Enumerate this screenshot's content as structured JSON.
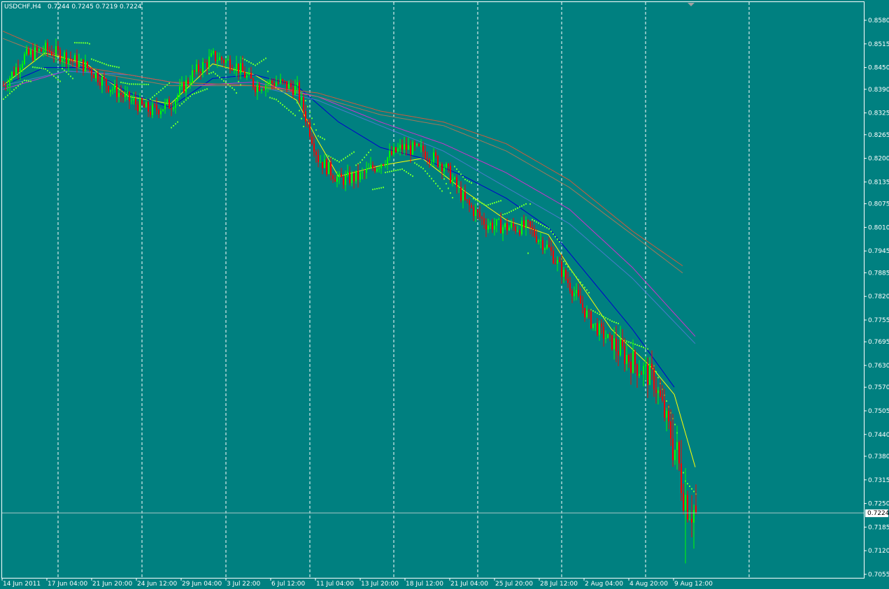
{
  "header": {
    "symbol": "USDCHF,H4",
    "ohlc": "0.7244 0.7245 0.7219 0.7224"
  },
  "current_price_label": "0.7224",
  "chart_data": {
    "type": "candlestick",
    "symbol": "USDCHF",
    "timeframe": "H4",
    "ylim": [
      0.7055,
      0.8605
    ],
    "y_ticks": [
      "0.8580",
      "0.8515",
      "0.8450",
      "0.8390",
      "0.8325",
      "0.8265",
      "0.8200",
      "0.8135",
      "0.8075",
      "0.8010",
      "0.7945",
      "0.7885",
      "0.7820",
      "0.7755",
      "0.7695",
      "0.7630",
      "0.7570",
      "0.7505",
      "0.7440",
      "0.7380",
      "0.7315",
      "0.7250",
      "0.7185",
      "0.7120",
      "0.7055"
    ],
    "x_ticks": [
      "14 Jun 2011",
      "17 Jun 04:00",
      "21 Jun 20:00",
      "24 Jun 12:00",
      "29 Jun 04:00",
      "3 Jul 22:00",
      "6 Jul 12:00",
      "11 Jul 04:00",
      "13 Jul 20:00",
      "18 Jul 12:00",
      "21 Jul 04:00",
      "25 Jul 20:00",
      "28 Jul 12:00",
      "2 Aug 04:00",
      "4 Aug 20:00",
      "9 Aug 12:00"
    ],
    "grid": "vertical dashed separators",
    "current_price": 0.7224,
    "close_path": [
      [
        0,
        0.84
      ],
      [
        10,
        0.848
      ],
      [
        20,
        0.85
      ],
      [
        30,
        0.848
      ],
      [
        40,
        0.845
      ],
      [
        50,
        0.84
      ],
      [
        60,
        0.836
      ],
      [
        70,
        0.833
      ],
      [
        80,
        0.835
      ],
      [
        90,
        0.843
      ],
      [
        100,
        0.848
      ],
      [
        110,
        0.846
      ],
      [
        120,
        0.84
      ],
      [
        130,
        0.841
      ],
      [
        140,
        0.839
      ],
      [
        150,
        0.82
      ],
      [
        160,
        0.814
      ],
      [
        170,
        0.815
      ],
      [
        180,
        0.819
      ],
      [
        190,
        0.823
      ],
      [
        200,
        0.822
      ],
      [
        210,
        0.818
      ],
      [
        220,
        0.808
      ],
      [
        230,
        0.802
      ],
      [
        240,
        0.801
      ],
      [
        250,
        0.801
      ],
      [
        260,
        0.795
      ],
      [
        270,
        0.785
      ],
      [
        280,
        0.775
      ],
      [
        290,
        0.769
      ],
      [
        300,
        0.764
      ],
      [
        310,
        0.759
      ],
      [
        320,
        0.74
      ],
      [
        325,
        0.727
      ],
      [
        330,
        0.722
      ]
    ],
    "candle_colors": {
      "up": "#00ff00",
      "down": "#ff0000"
    },
    "indicators": [
      {
        "kind": "moving-average",
        "color": "#ffff00",
        "path": [
          [
            0,
            0.84
          ],
          [
            20,
            0.849
          ],
          [
            40,
            0.846
          ],
          [
            60,
            0.837
          ],
          [
            80,
            0.835
          ],
          [
            100,
            0.846
          ],
          [
            120,
            0.843
          ],
          [
            140,
            0.836
          ],
          [
            150,
            0.825
          ],
          [
            160,
            0.815
          ],
          [
            180,
            0.818
          ],
          [
            200,
            0.82
          ],
          [
            220,
            0.811
          ],
          [
            240,
            0.803
          ],
          [
            260,
            0.799
          ],
          [
            270,
            0.79
          ],
          [
            290,
            0.773
          ],
          [
            310,
            0.762
          ],
          [
            320,
            0.755
          ],
          [
            330,
            0.735
          ]
        ]
      },
      {
        "kind": "moving-average",
        "color": "#0000cd",
        "path": [
          [
            0,
            0.84
          ],
          [
            20,
            0.845
          ],
          [
            40,
            0.845
          ],
          [
            60,
            0.838
          ],
          [
            80,
            0.834
          ],
          [
            100,
            0.842
          ],
          [
            120,
            0.843
          ],
          [
            140,
            0.84
          ],
          [
            160,
            0.83
          ],
          [
            180,
            0.823
          ],
          [
            200,
            0.82
          ],
          [
            220,
            0.815
          ],
          [
            240,
            0.809
          ],
          [
            260,
            0.801
          ],
          [
            280,
            0.787
          ],
          [
            300,
            0.773
          ],
          [
            320,
            0.757
          ]
        ]
      },
      {
        "kind": "moving-average",
        "color": "#cc33cc",
        "path": [
          [
            0,
            0.839
          ],
          [
            30,
            0.844
          ],
          [
            60,
            0.843
          ],
          [
            90,
            0.84
          ],
          [
            120,
            0.841
          ],
          [
            150,
            0.837
          ],
          [
            180,
            0.83
          ],
          [
            210,
            0.824
          ],
          [
            240,
            0.816
          ],
          [
            270,
            0.806
          ],
          [
            300,
            0.79
          ],
          [
            330,
            0.771
          ]
        ]
      },
      {
        "kind": "moving-average",
        "color": "#4a7acb",
        "path": [
          [
            0,
            0.84
          ],
          [
            30,
            0.844
          ],
          [
            60,
            0.843
          ],
          [
            90,
            0.84
          ],
          [
            120,
            0.84
          ],
          [
            150,
            0.836
          ],
          [
            180,
            0.829
          ],
          [
            210,
            0.822
          ],
          [
            240,
            0.812
          ],
          [
            270,
            0.802
          ],
          [
            300,
            0.787
          ],
          [
            330,
            0.769
          ]
        ]
      },
      {
        "kind": "moving-average",
        "color": "#cd5c3c",
        "path": [
          [
            0,
            0.855
          ],
          [
            40,
            0.845
          ],
          [
            80,
            0.841
          ],
          [
            120,
            0.84
          ],
          [
            150,
            0.838
          ],
          [
            180,
            0.833
          ],
          [
            210,
            0.83
          ],
          [
            240,
            0.824
          ],
          [
            270,
            0.814
          ],
          [
            300,
            0.8
          ],
          [
            325,
            0.79
          ]
        ]
      },
      {
        "kind": "moving-average",
        "color": "#a0785a",
        "path": [
          [
            0,
            0.853
          ],
          [
            40,
            0.844
          ],
          [
            80,
            0.84
          ],
          [
            120,
            0.84
          ],
          [
            150,
            0.837
          ],
          [
            180,
            0.832
          ],
          [
            210,
            0.829
          ],
          [
            240,
            0.822
          ],
          [
            270,
            0.812
          ],
          [
            300,
            0.799
          ],
          [
            325,
            0.788
          ]
        ]
      }
    ],
    "parabolic_sar": {
      "color": "#66ff33"
    }
  }
}
